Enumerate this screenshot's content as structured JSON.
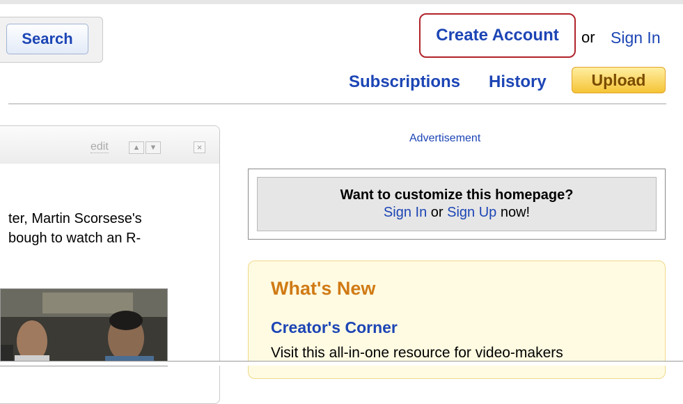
{
  "header": {
    "search_label": "Search",
    "create_account_label": "Create Account",
    "or_text": "or",
    "sign_in_label": "Sign In"
  },
  "nav": {
    "subscriptions_label": "Subscriptions",
    "history_label": "History",
    "upload_label": "Upload"
  },
  "module": {
    "edit_label": "edit",
    "text_line1": "ter, Martin Scorsese's",
    "text_line2": "bough to watch an R-"
  },
  "ad": {
    "label": "Advertisement"
  },
  "customize": {
    "title": "Want to customize this homepage?",
    "sign_in": "Sign In",
    "or": "or",
    "sign_up": "Sign Up",
    "now": "now!"
  },
  "whats_new": {
    "title": "What's New",
    "item_title": "Creator's Corner",
    "item_desc": "Visit this all-in-one resource for video-makers"
  },
  "icons": [
    "arrow-up-icon",
    "arrow-down-icon",
    "close-icon"
  ],
  "colors": {
    "link": "#1c45b5",
    "highlight_border": "#b0232a",
    "upload_bg": "#f5c437",
    "whats_new_title": "#d07a14"
  }
}
